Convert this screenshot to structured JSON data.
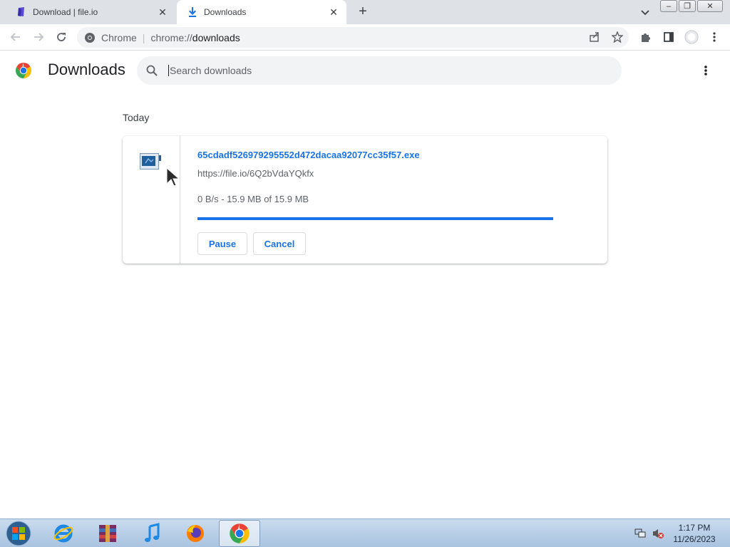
{
  "browser": {
    "tabs": [
      {
        "label": "Download | file.io",
        "active": false,
        "icon": "fileio-icon"
      },
      {
        "label": "Downloads",
        "active": true,
        "icon": "download-icon"
      }
    ],
    "new_tab_label": "+",
    "window_controls": {
      "minimize": "–",
      "restore": "❐",
      "close": "✕"
    },
    "omnibox": {
      "chip": "Chrome",
      "separator": "|",
      "url_scheme": "chrome://",
      "url_host": "downloads"
    }
  },
  "downloads_page": {
    "title": "Downloads",
    "search": {
      "placeholder": "Search downloads",
      "value": ""
    },
    "date_heading": "Today",
    "item": {
      "filename": "65cdadf526979295552d472dacaa92077cc35f57.exe",
      "source_url": "https://file.io/6Q2bVdaYQkfx",
      "status": "0 B/s - 15.9 MB of 15.9 MB",
      "progress": 1.0,
      "pause_label": "Pause",
      "cancel_label": "Cancel"
    }
  },
  "taskbar": {
    "apps": [
      "start-orb",
      "internet-explorer",
      "winrar",
      "itunes",
      "firefox",
      "chrome"
    ],
    "active_app": "chrome",
    "clock": {
      "time": "1:17 PM",
      "date": "11/26/2023"
    }
  },
  "colors": {
    "accent": "#1a73e8",
    "tabstrip": "#dee1e6",
    "omnibox_bg": "#f1f3f4",
    "taskbar": "#b9cfe8"
  }
}
